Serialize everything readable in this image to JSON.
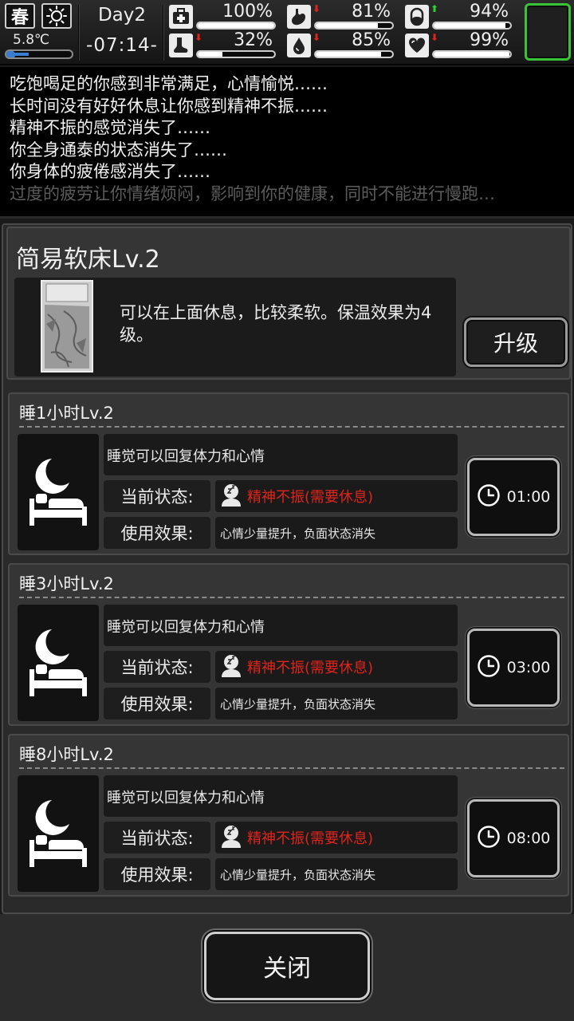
{
  "hud": {
    "season": "春",
    "temperature": "5.8℃",
    "temperature_level": 0.3,
    "day": "Day2",
    "time": "-07:14-",
    "stats": [
      {
        "id": "health",
        "icon": "first-aid-icon",
        "arrow": "",
        "percent_text": "100%",
        "value": 100
      },
      {
        "id": "hunger",
        "icon": "stomach-icon",
        "arrow": "down",
        "percent_text": "81%",
        "value": 81
      },
      {
        "id": "medicine",
        "icon": "pill-icon",
        "arrow": "up",
        "percent_text": "94%",
        "value": 94
      },
      {
        "id": "stamina",
        "icon": "foot-icon",
        "arrow": "down",
        "percent_text": "32%",
        "value": 32
      },
      {
        "id": "thirst",
        "icon": "water-drop-icon",
        "arrow": "down",
        "percent_text": "85%",
        "value": 85
      },
      {
        "id": "mood",
        "icon": "heart-icon",
        "arrow": "down",
        "percent_text": "99%",
        "value": 99
      }
    ]
  },
  "log": {
    "lines": [
      "吃饱喝足的你感到非常满足，心情愉悦……",
      "长时间没有好好休息让你感到精神不振……",
      "精神不振的感觉消失了……",
      "你全身通泰的状态消失了……",
      "你身体的疲倦感消失了……",
      "过度的疲劳让你情绪烦闷，影响到你的健康，同时不能进行慢跑…"
    ]
  },
  "item": {
    "title": "简易软床Lv.2",
    "description": "可以在上面休息，比较柔软。保温效果为4级。",
    "upgrade_label": "升级"
  },
  "sleep_options": [
    {
      "title": "睡1小时Lv.2",
      "description": "睡觉可以回复体力和心情",
      "status_label": "当前状态:",
      "status_value": "精神不振(需要休息)",
      "effect_label": "使用效果:",
      "effect_value": "心情少量提升，负面状态消失",
      "time": "01:00"
    },
    {
      "title": "睡3小时Lv.2",
      "description": "睡觉可以回复体力和心情",
      "status_label": "当前状态:",
      "status_value": "精神不振(需要休息)",
      "effect_label": "使用效果:",
      "effect_value": "心情少量提升，负面状态消失",
      "time": "03:00"
    },
    {
      "title": "睡8小时Lv.2",
      "description": "睡觉可以回复体力和心情",
      "status_label": "当前状态:",
      "status_value": "精神不振(需要休息)",
      "effect_label": "使用效果:",
      "effect_value": "心情少量提升，负面状态消失",
      "time": "08:00"
    }
  ],
  "close_label": "关闭",
  "colors": {
    "status_red": "#e0241c",
    "arrow_up": "#2fd12f",
    "slot_green": "#39c339",
    "temp_blue": "#3a7ed1"
  }
}
